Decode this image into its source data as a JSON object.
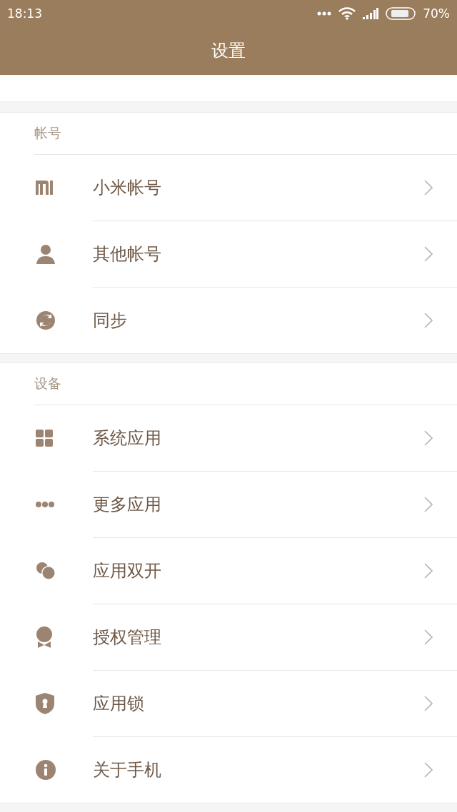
{
  "status_bar": {
    "time": "18:13",
    "battery": "70%"
  },
  "header": {
    "title": "设置"
  },
  "sections": [
    {
      "title": "帐号",
      "items": [
        {
          "label": "小米帐号",
          "kind": "logo"
        },
        {
          "label": "其他帐号",
          "kind": "person"
        },
        {
          "label": "同步",
          "kind": "sync"
        }
      ]
    },
    {
      "title": "设备",
      "items": [
        {
          "label": "系统应用",
          "kind": "grid"
        },
        {
          "label": "更多应用",
          "kind": "dots"
        },
        {
          "label": "应用双开",
          "kind": "twin"
        },
        {
          "label": "授权管理",
          "kind": "badge"
        },
        {
          "label": "应用锁",
          "kind": "lock"
        },
        {
          "label": "关于手机",
          "kind": "info"
        }
      ]
    }
  ]
}
